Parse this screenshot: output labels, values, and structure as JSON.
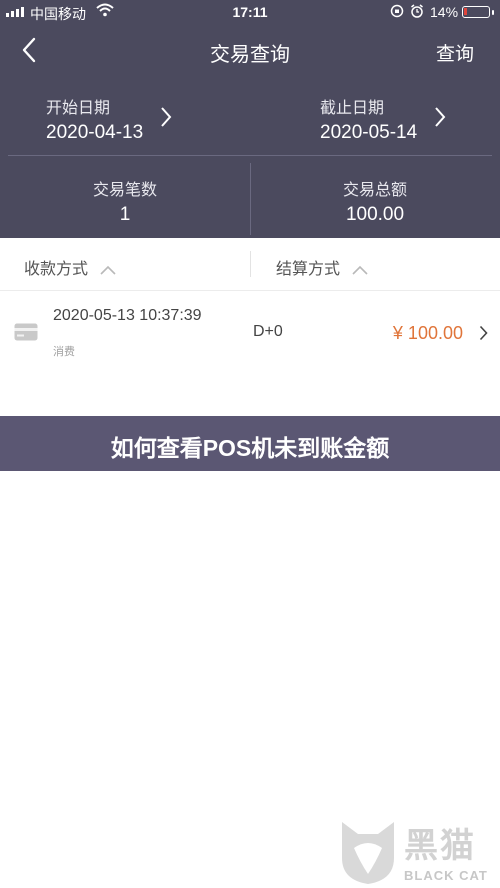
{
  "status_bar": {
    "carrier": "中国移动",
    "time": "17:11",
    "battery_percent": "14%",
    "battery_level": 0.14,
    "battery_color": "#e0463d"
  },
  "nav": {
    "title": "交易查询",
    "action_label": "查询",
    "back_icon": "chevron-left-icon"
  },
  "date_range": {
    "start_label": "开始日期",
    "start_value": "2020-04-13",
    "end_label": "截止日期",
    "end_value": "2020-05-14"
  },
  "summary": {
    "count_label": "交易笔数",
    "count_value": "1",
    "total_label": "交易总额",
    "total_value": "100.00"
  },
  "filters": {
    "payment_method": "收款方式",
    "settlement_method": "结算方式"
  },
  "transactions": [
    {
      "time": "2020-05-13 10:37:39",
      "type": "消费",
      "settlement": "D+0",
      "amount": "¥ 100.00",
      "icon": "card-icon"
    }
  ],
  "banner": {
    "text": "如何查看POS机未到账金额"
  },
  "watermark": {
    "brand": "黑猫",
    "sub": "BLACK CAT"
  },
  "colors": {
    "header_bg": "#4b4a5e",
    "banner_bg": "#5b5773",
    "amount": "#e0753a"
  }
}
